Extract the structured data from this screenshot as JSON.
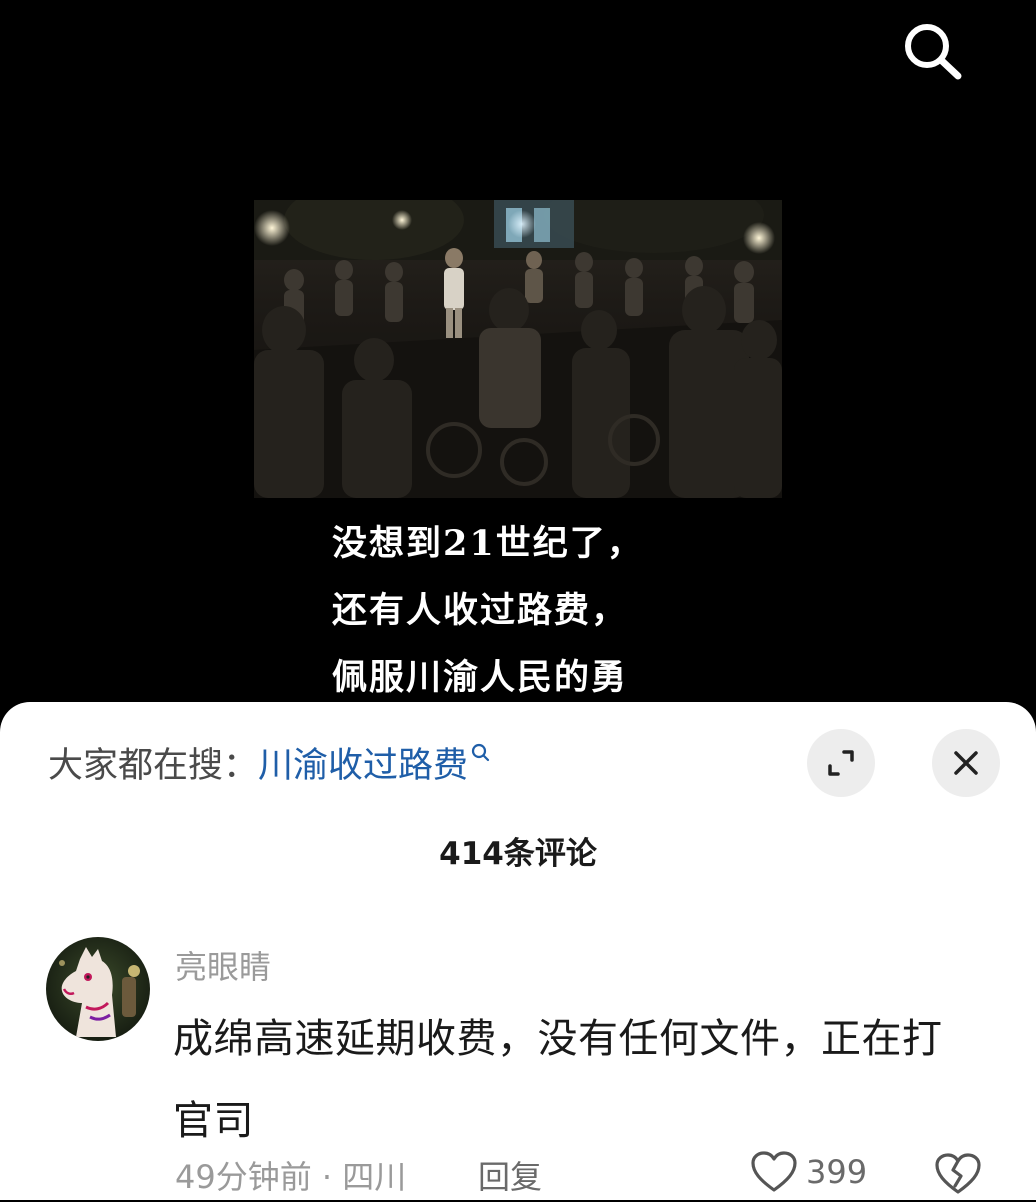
{
  "video": {
    "subtitle_lines": [
      "没想到21世纪了，",
      "还有人收过路费，",
      "佩服川渝人民的勇"
    ]
  },
  "hot_search": {
    "label": "大家都在搜：",
    "term": "川渝收过路费",
    "term_color": "#1f5ea8"
  },
  "comments_header": {
    "count_label": "414条评论"
  },
  "comments": [
    {
      "username": "亮眼睛",
      "text": "成绵高速延期收费，没有任何文件，正在打官司",
      "meta": "49分钟前 · 四川",
      "reply_label": "回复",
      "like_count": "399"
    }
  ],
  "icons": {
    "search": "search-icon",
    "expand": "expand-icon",
    "close": "close-icon",
    "like": "heart-icon",
    "dislike": "broken-heart-icon"
  },
  "colors": {
    "video_background": "#000000",
    "sheet_background": "#ffffff",
    "secondary_text": "#9a9a9a",
    "button_background": "#ededed"
  }
}
